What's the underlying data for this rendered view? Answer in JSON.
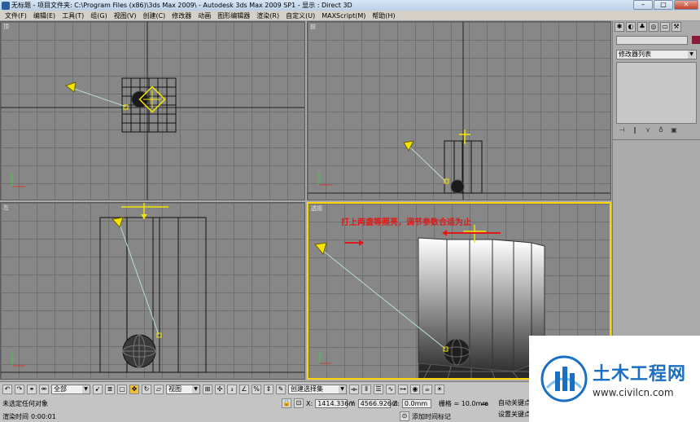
{
  "title_bar": {
    "doc": "无标题",
    "project": "- 项目文件夹: C:\\Program Files (x86)\\3ds Max 2009\\",
    "app": "- Autodesk 3ds Max  2009 SP1",
    "display": "- 显示 : Direct 3D"
  },
  "menu": [
    "文件(F)",
    "编辑(E)",
    "工具(T)",
    "组(G)",
    "视图(V)",
    "创建(C)",
    "修改器",
    "动画",
    "图形编辑器",
    "渲染(R)",
    "自定义(U)",
    "MAXScript(M)",
    "帮助(H)"
  ],
  "viewports": {
    "top": {
      "label": "顶"
    },
    "front": {
      "label": "前"
    },
    "left": {
      "label": "左"
    },
    "perspective": {
      "label": "透视",
      "annotation": "打上两盏等照亮，调节参数合适为止"
    }
  },
  "command_panel": {
    "modifier_list": "修改器列表"
  },
  "toolbar": {
    "select_filter": "全部",
    "reference_coord": "视图",
    "named_selection": "创建选择集"
  },
  "status": {
    "selection": "未选定任何对象",
    "render_time_label": "渲染时间",
    "render_time_value": "0:00:01",
    "add_time_tag": "添加时间标记",
    "x_label": "X:",
    "x_value": "1414.336m",
    "y_label": "Y:",
    "y_value": "4566.926m",
    "z_label": "Z:",
    "z_value": "0.0mm",
    "grid": "栅格 = 10.0mm",
    "auto_key": "自动关键点",
    "set_key": "设置关键点"
  },
  "watermark": {
    "title": "土木工程网",
    "url": "www.civilcn.com"
  },
  "colors": {
    "viewport_bg": "#878787",
    "grid_line": "#6f6f6f",
    "light_yellow": "#f4e400",
    "annotation_red": "#e01818",
    "watermark_blue": "#1b6fc0"
  }
}
